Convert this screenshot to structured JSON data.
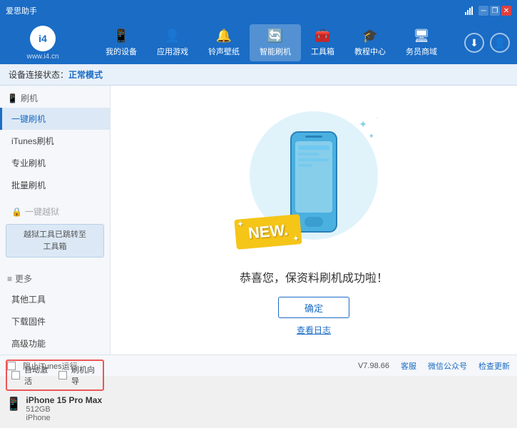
{
  "app": {
    "name": "爱思助手",
    "url": "www.i4.cn",
    "logo_letter": "i4"
  },
  "window_controls": {
    "min": "─",
    "max": "□",
    "close": "✕",
    "restore": "❐"
  },
  "nav": {
    "items": [
      {
        "id": "my-device",
        "icon": "📱",
        "label": "我的设备"
      },
      {
        "id": "apps-games",
        "icon": "👤",
        "label": "应用游戏"
      },
      {
        "id": "ringtones",
        "icon": "🔔",
        "label": "铃声壁纸"
      },
      {
        "id": "smart-flash",
        "icon": "🔄",
        "label": "智能刷机",
        "active": true
      },
      {
        "id": "toolbox",
        "icon": "🧰",
        "label": "工具箱"
      },
      {
        "id": "tutorials",
        "icon": "🎓",
        "label": "教程中心"
      },
      {
        "id": "service",
        "icon": "🖥",
        "label": "务员商域"
      }
    ]
  },
  "statusbar": {
    "prefix": "设备连接状态：",
    "mode": "正常模式"
  },
  "sidebar": {
    "flash_section_label": "刷机",
    "flash_section_icon": "📱",
    "items": [
      {
        "id": "one-key-flash",
        "label": "一键刷机",
        "active": true
      },
      {
        "id": "itunes-flash",
        "label": "iTunes刷机"
      },
      {
        "id": "pro-flash",
        "label": "专业刷机"
      },
      {
        "id": "batch-flash",
        "label": "批量刷机"
      }
    ],
    "disabled_label": "一键越狱",
    "disabled_icon": "🔒",
    "notice_line1": "越狱工具已跳转至",
    "notice_line2": "工具箱",
    "more_section_label": "更多",
    "more_items": [
      {
        "id": "other-tools",
        "label": "其他工具"
      },
      {
        "id": "download-firmware",
        "label": "下载固件"
      },
      {
        "id": "advanced",
        "label": "高级功能"
      }
    ],
    "auto_activate_label": "自动激活",
    "guide_label": "刷机向导",
    "device_name": "iPhone 15 Pro Max",
    "device_storage": "512GB",
    "device_type": "iPhone"
  },
  "content": {
    "new_label": "NEW.",
    "success_text": "恭喜您，保资料刷机成功啦！",
    "confirm_button": "确定",
    "log_link": "查看日志"
  },
  "bottombar": {
    "itunes_label": "阻止iTunes运行",
    "version": "V7.98.66",
    "client_label": "客服",
    "wechat_label": "微信公众号",
    "check_update_label": "检查更新"
  }
}
